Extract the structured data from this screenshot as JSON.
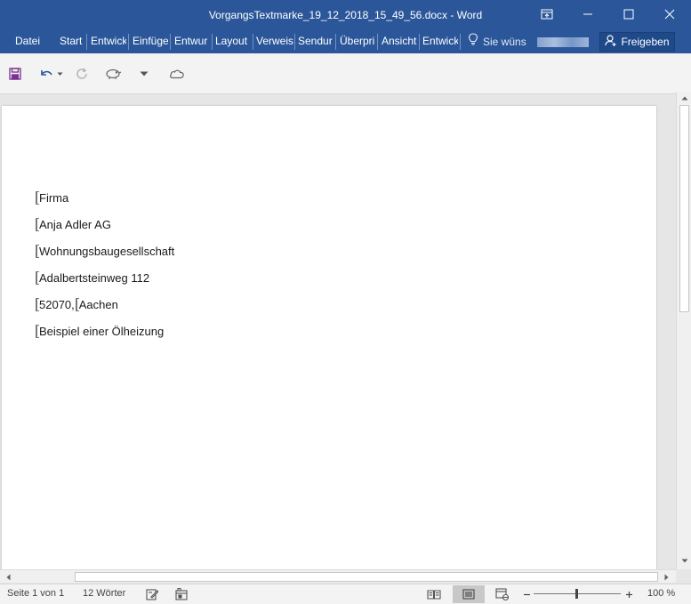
{
  "window": {
    "title": "VorgangsTextmarke_19_12_2018_15_49_56.docx - Word"
  },
  "ribbon": {
    "tabs": [
      {
        "label": "Datei"
      },
      {
        "label": "Start"
      },
      {
        "label": "Entwick"
      },
      {
        "label": "Einfüge"
      },
      {
        "label": "Entwur"
      },
      {
        "label": "Layout"
      },
      {
        "label": "Verweis"
      },
      {
        "label": "Sendur"
      },
      {
        "label": "Überpri"
      },
      {
        "label": "Ansicht"
      },
      {
        "label": "Entwick"
      }
    ],
    "tell_me": "Sie wüns",
    "share": "Freigeben"
  },
  "document": {
    "paragraphs": [
      {
        "text": "Firma"
      },
      {
        "text": "Anja Adler AG"
      },
      {
        "text": "Wohnungsbaugesellschaft"
      },
      {
        "text": "Adalbertsteinweg 112"
      },
      {
        "part1": "52070,",
        "part2": "Aachen"
      },
      {
        "text": "Beispiel einer Ölheizung"
      }
    ]
  },
  "status": {
    "page": "Seite 1 von 1",
    "words": "12 Wörter",
    "zoom": "100 %",
    "zoom_level_percent": 100
  },
  "colors": {
    "accent": "#2b579a"
  }
}
